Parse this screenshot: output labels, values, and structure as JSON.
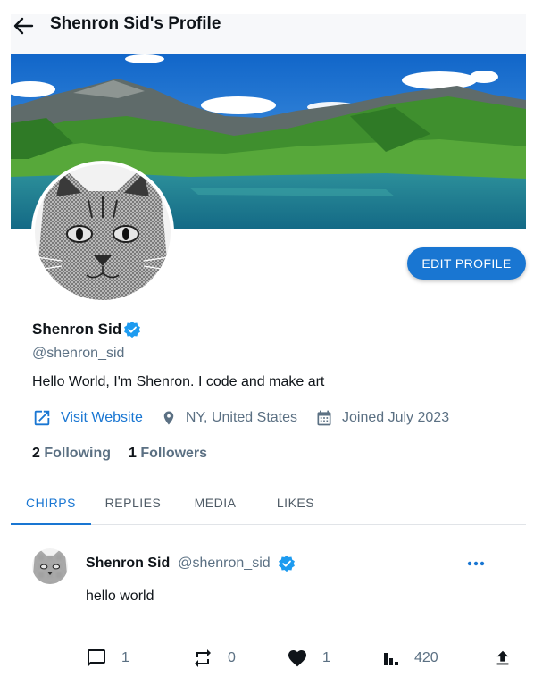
{
  "header": {
    "title": "Shenron Sid's Profile"
  },
  "profile": {
    "name": "Shenron Sid",
    "handle": "@shenron_sid",
    "bio": "Hello World, I'm Shenron. I code and make art",
    "website_label": "Visit Website",
    "location": "NY, United States",
    "joined": "Joined July 2023",
    "following_count": "2",
    "following_label": "Following",
    "followers_count": "1",
    "followers_label": "Followers",
    "edit_label": "EDIT PROFILE"
  },
  "tabs": [
    {
      "label": "CHIRPS",
      "active": true
    },
    {
      "label": "REPLIES"
    },
    {
      "label": "MEDIA"
    },
    {
      "label": "LIKES"
    }
  ],
  "post": {
    "name": "Shenron Sid",
    "handle": "@shenron_sid",
    "text": "hello world",
    "replies": "1",
    "rechirps": "0",
    "likes": "1",
    "views": "420"
  },
  "colors": {
    "accent": "#1976d2",
    "verified": "#1d9bf0",
    "muted": "#5b7083"
  }
}
